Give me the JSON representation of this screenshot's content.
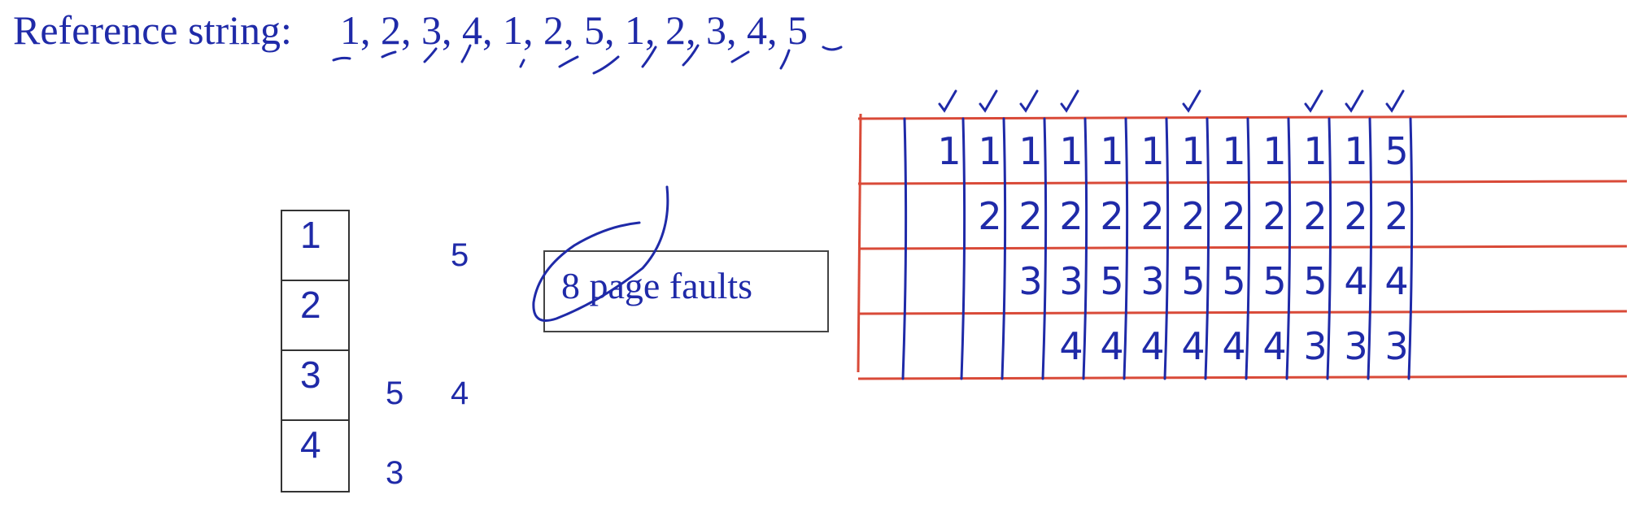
{
  "reference": {
    "label": "Reference string:",
    "values": "1, 2, 3, 4, 1, 2, 5, 1, 2, 3, 4, 5"
  },
  "frames": [
    "1",
    "2",
    "3",
    "4"
  ],
  "side_numbers": {
    "top": "5",
    "middle_left": "5",
    "middle_right": "4",
    "bottom": "3"
  },
  "fault_summary": "8 page faults",
  "table": {
    "columns": [
      [
        "1",
        "",
        "",
        ""
      ],
      [
        "1",
        "2",
        "",
        ""
      ],
      [
        "1",
        "2",
        "3",
        ""
      ],
      [
        "1",
        "2",
        "3",
        "4"
      ],
      [
        "1",
        "2",
        "5",
        "4"
      ],
      [
        "1",
        "2",
        "3",
        "4"
      ],
      [
        "1",
        "2",
        "5",
        "4"
      ],
      [
        "1",
        "2",
        "5",
        "4"
      ],
      [
        "1",
        "2",
        "5",
        "4"
      ],
      [
        "1",
        "2",
        "5",
        "3"
      ],
      [
        "1",
        "2",
        "4",
        "3"
      ],
      [
        "5",
        "2",
        "4",
        "3"
      ]
    ],
    "checkmarks": [
      true,
      true,
      true,
      true,
      false,
      false,
      true,
      false,
      false,
      true,
      true,
      true
    ]
  },
  "colors": {
    "ink": "#1f2aa8",
    "grid": "#d94a38",
    "box": "#333333"
  }
}
